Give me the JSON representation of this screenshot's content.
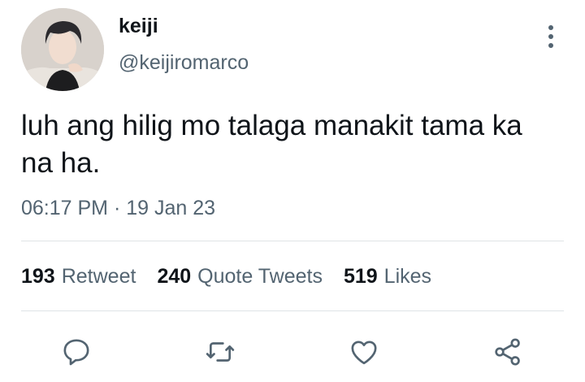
{
  "tweet": {
    "display_name": "keiji",
    "handle": "@keijiromarco",
    "text": "luh ang hilig mo talaga manakit tama ka na ha.",
    "time": "06:17 PM",
    "separator": "·",
    "date": "19 Jan 23"
  },
  "stats": {
    "retweets": {
      "count": "193",
      "label": "Retweet"
    },
    "quotes": {
      "count": "240",
      "label": "Quote Tweets"
    },
    "likes": {
      "count": "519",
      "label": "Likes"
    }
  },
  "actions": {
    "reply_icon": "comment-bubble-icon",
    "retweet_icon": "retweet-icon",
    "like_icon": "heart-icon",
    "share_icon": "share-nodes-icon"
  },
  "colors": {
    "text_primary": "#0f1419",
    "text_secondary": "#536471",
    "divider": "#dfe3e6"
  }
}
